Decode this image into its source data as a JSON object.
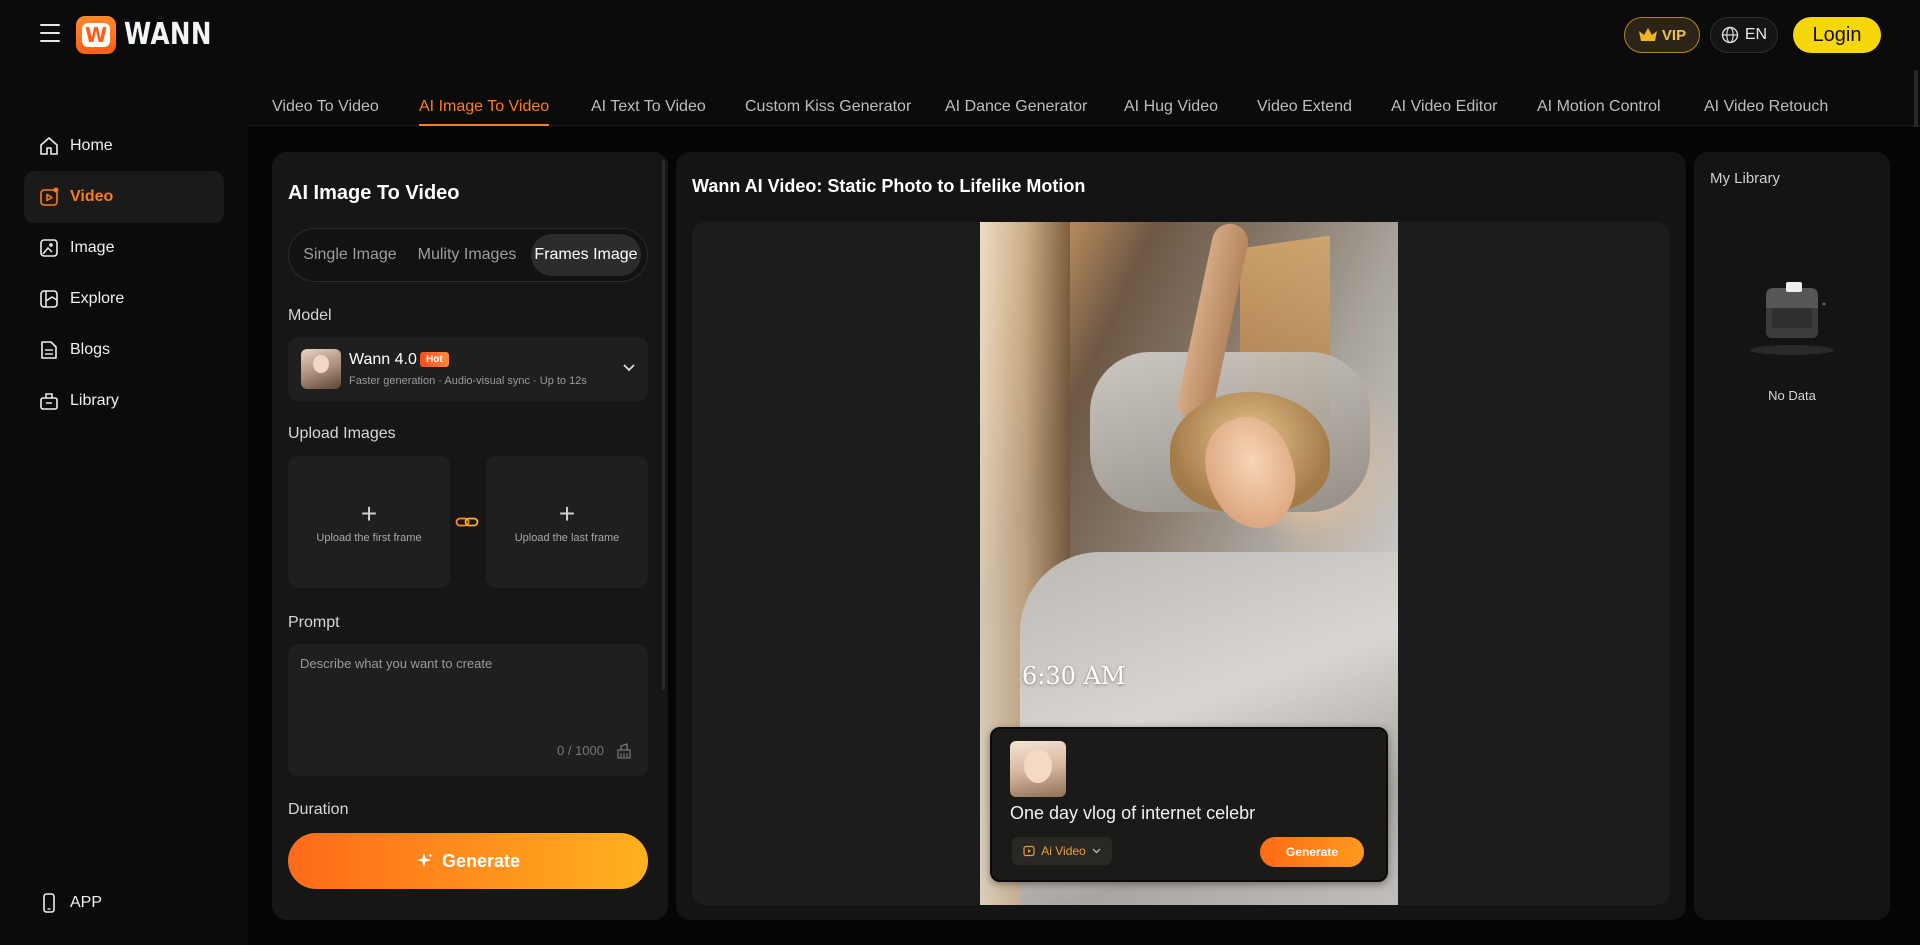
{
  "brand": {
    "name": "WANN",
    "logo_letter": "W"
  },
  "header": {
    "vip_label": "VIP",
    "lang_label": "EN",
    "login_label": "Login"
  },
  "sidebar": {
    "items": [
      {
        "label": "Home",
        "icon": "home-icon"
      },
      {
        "label": "Video",
        "icon": "video-icon",
        "active": true
      },
      {
        "label": "Image",
        "icon": "image-icon"
      },
      {
        "label": "Explore",
        "icon": "explore-icon"
      },
      {
        "label": "Blogs",
        "icon": "blogs-icon"
      },
      {
        "label": "Library",
        "icon": "library-icon"
      }
    ],
    "app_label": "APP"
  },
  "tabs": [
    {
      "label": "Video To Video"
    },
    {
      "label": "AI Image To Video",
      "active": true
    },
    {
      "label": "AI Text To Video"
    },
    {
      "label": "Custom Kiss Generator"
    },
    {
      "label": "AI Dance Generator"
    },
    {
      "label": "AI Hug Video"
    },
    {
      "label": "Video Extend"
    },
    {
      "label": "AI Video Editor"
    },
    {
      "label": "AI Motion Control"
    },
    {
      "label": "AI Video Retouch"
    }
  ],
  "left_panel": {
    "title": "AI Image To Video",
    "modes": [
      {
        "label": "Single Image"
      },
      {
        "label": "Mulity Images"
      },
      {
        "label": "Frames Image",
        "active": true
      }
    ],
    "model_label": "Model",
    "model": {
      "name": "Wann 4.0",
      "badge": "Hot",
      "description": "Faster generation · Audio-visual sync · Up to 12s"
    },
    "upload_label": "Upload Images",
    "upload_first": "Upload the first frame",
    "upload_last": "Upload the last frame",
    "prompt_label": "Prompt",
    "prompt_placeholder": "Describe what you want to create",
    "prompt_value": "",
    "char_count": "0 / 1000",
    "duration_label": "Duration",
    "generate_label": "Generate"
  },
  "center_panel": {
    "title": "Wann AI Video: Static Photo to Lifelike Motion",
    "preview": {
      "time": "6:30 AM",
      "card_text": "One day vlog of internet celebr",
      "card_pill": "Ai Video",
      "card_button": "Generate"
    }
  },
  "right_panel": {
    "title": "My Library",
    "empty_text": "No Data"
  },
  "colors": {
    "accent": "#ff7a1a",
    "login_bg": "#f5d70a",
    "vip_text": "#f0c050",
    "generate_start": "#ff6a1a",
    "generate_end": "#ffb21e"
  }
}
